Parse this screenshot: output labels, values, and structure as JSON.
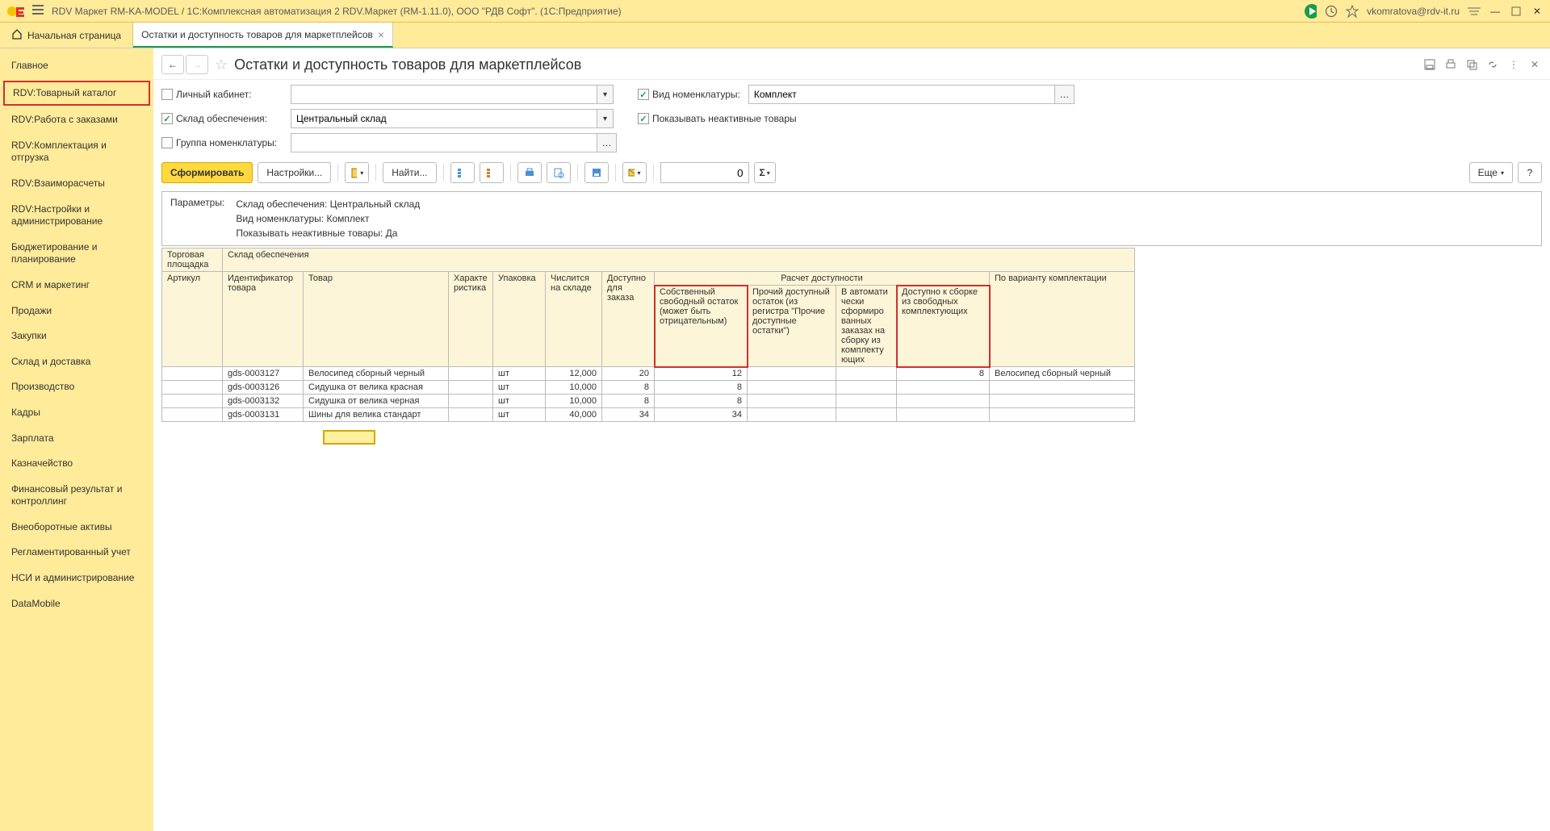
{
  "title_bar": {
    "app_title": "RDV Маркет RM-KA-MODEL / 1С:Комплексная автоматизация 2 RDV.Маркет (RM-1.11.0), ООО \"РДВ Софт\".  (1С:Предприятие)",
    "user": "vkomratova@rdv-it.ru"
  },
  "tabs": {
    "home": "Начальная страница",
    "active_tab": "Остатки и доступность товаров для маркетплейсов"
  },
  "sidebar": {
    "items": [
      "Главное",
      "RDV:Товарный каталог",
      "RDV:Работа с заказами",
      "RDV:Комплектация и отгрузка",
      "RDV:Взаиморасчеты",
      "RDV:Настройки и администрирование",
      "Бюджетирование и планирование",
      "CRM и маркетинг",
      "Продажи",
      "Закупки",
      "Склад и доставка",
      "Производство",
      "Кадры",
      "Зарплата",
      "Казначейство",
      "Финансовый результат и контроллинг",
      "Внеоборотные активы",
      "Регламентированный учет",
      "НСИ и администрирование",
      "DataMobile"
    ],
    "highlighted_index": 1
  },
  "page": {
    "title": "Остатки и доступность товаров для маркетплейсов"
  },
  "filters": {
    "personal_cabinet_label": "Личный кабинет:",
    "personal_cabinet_checked": false,
    "personal_cabinet_value": "",
    "vid_nom_label": "Вид номенклатуры:",
    "vid_nom_checked": true,
    "vid_nom_value": "Комплект",
    "sklad_label": "Склад обеспечения:",
    "sklad_checked": true,
    "sklad_value": "Центральный склад",
    "show_inactive_label": "Показывать неактивные товары",
    "show_inactive_checked": true,
    "group_label": "Группа номенклатуры:",
    "group_checked": false,
    "group_value": ""
  },
  "toolbar": {
    "generate": "Сформировать",
    "settings": "Настройки...",
    "find": "Найти...",
    "more": "Еще",
    "help": "?",
    "num_value": "0"
  },
  "report": {
    "params_label": "Параметры:",
    "params_lines": [
      "Склад обеспечения: Центральный склад",
      "Вид номенклатуры: Комплект",
      "Показывать неактивные товары: Да"
    ],
    "group_headers": {
      "torgovaya": "Торговая площадка",
      "sklad": "Склад обеспечения",
      "raschet": "Расчет доступности"
    },
    "columns": {
      "artikul": "Артикул",
      "ident": "Идентификатор товара",
      "tovar": "Товар",
      "harakt": "Характе ристика",
      "upak": "Упаковка",
      "chisl": "Числится на складе",
      "dostup_zakaz": "Доступно для заказа",
      "sobstv": "Собственный свободный остаток (может быть отрицательным)",
      "prochiy": "Прочий доступный остаток (из регистра \"Прочие доступные остатки\")",
      "avtom": "В автомати чески сформиро ванных заказах на сборку из комплекту ющих",
      "dostup_sborke": "Доступно к сборке из свободных комплектующих",
      "variant": "По варианту комплектации"
    },
    "rows": [
      {
        "ident": "gds-0003127",
        "tovar": "Велосипед сборный черный",
        "upak": "шт",
        "chisl": "12,000",
        "dostup_zakaz": "20",
        "sobstv": "12",
        "dostup_sborke": "8",
        "variant": "Велосипед сборный черный"
      },
      {
        "ident": "gds-0003126",
        "tovar": "Сидушка от велика красная",
        "upak": "шт",
        "chisl": "10,000",
        "dostup_zakaz": "8",
        "sobstv": "8",
        "dostup_sborke": "",
        "variant": ""
      },
      {
        "ident": "gds-0003132",
        "tovar": "Сидушка от велика черная",
        "upak": "шт",
        "chisl": "10,000",
        "dostup_zakaz": "8",
        "sobstv": "8",
        "dostup_sborke": "",
        "variant": ""
      },
      {
        "ident": "gds-0003131",
        "tovar": "Шины для велика стандарт",
        "upak": "шт",
        "chisl": "40,000",
        "dostup_zakaz": "34",
        "sobstv": "34",
        "dostup_sborke": "",
        "variant": ""
      }
    ]
  }
}
